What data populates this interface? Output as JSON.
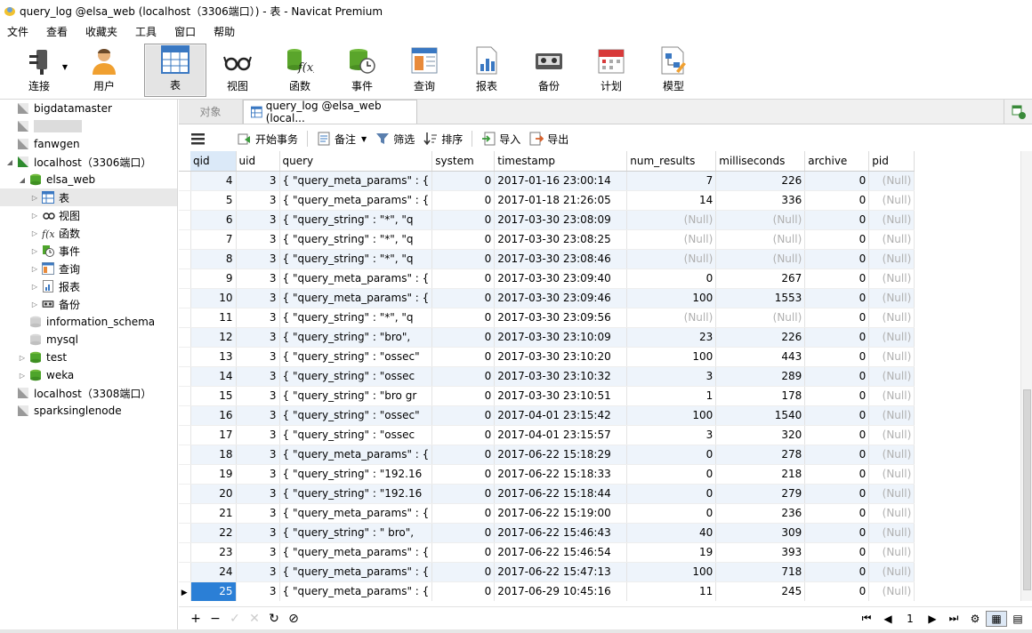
{
  "window": {
    "title": "query_log @elsa_web (localhost（3306端口）) - 表 - Navicat Premium"
  },
  "menu": [
    "文件",
    "查看",
    "收藏夹",
    "工具",
    "窗口",
    "帮助"
  ],
  "toolbar": {
    "connect": "连接",
    "user": "用户",
    "table": "表",
    "view": "视图",
    "function": "函数",
    "event": "事件",
    "query": "查询",
    "report": "报表",
    "backup": "备份",
    "schedule": "计划",
    "model": "模型"
  },
  "sidebar": {
    "items": [
      {
        "label": "bigdatamaster",
        "level": 0
      },
      {
        "label": "",
        "level": 0
      },
      {
        "label": "fanwgen",
        "level": 0
      },
      {
        "label": "localhost（3306端口）",
        "level": 0
      },
      {
        "label": "elsa_web",
        "level": 1
      },
      {
        "label": "表",
        "level": 2
      },
      {
        "label": "视图",
        "level": 2
      },
      {
        "label": "函数",
        "level": 2
      },
      {
        "label": "事件",
        "level": 2
      },
      {
        "label": "查询",
        "level": 2
      },
      {
        "label": "报表",
        "level": 2
      },
      {
        "label": "备份",
        "level": 2
      },
      {
        "label": "information_schema",
        "level": 1
      },
      {
        "label": "mysql",
        "level": 1
      },
      {
        "label": "test",
        "level": 1
      },
      {
        "label": "weka",
        "level": 1
      },
      {
        "label": "localhost（3308端口）",
        "level": 0
      },
      {
        "label": "sparksinglenode",
        "level": 0
      }
    ]
  },
  "tabs": {
    "objects": "对象",
    "active": "query_log @elsa_web (local..."
  },
  "actions": {
    "begin_tx": "开始事务",
    "note": "备注",
    "filter": "筛选",
    "sort": "排序",
    "import": "导入",
    "export": "导出"
  },
  "table": {
    "columns": [
      "qid",
      "uid",
      "query",
      "system",
      "timestamp",
      "num_results",
      "milliseconds",
      "archive",
      "pid"
    ],
    "rows": [
      [
        "4",
        "3",
        "{   \"query_meta_params\" : {",
        "0",
        "2017-01-16 23:00:14",
        "7",
        "226",
        "0",
        "(Null)"
      ],
      [
        "5",
        "3",
        "{   \"query_meta_params\" : {",
        "0",
        "2017-01-18 21:26:05",
        "14",
        "336",
        "0",
        "(Null)"
      ],
      [
        "6",
        "3",
        "{   \"query_string\" : \"*\",    \"q",
        "0",
        "2017-03-30 23:08:09",
        "(Null)",
        "(Null)",
        "0",
        "(Null)"
      ],
      [
        "7",
        "3",
        "{   \"query_string\" : \"*\",    \"q",
        "0",
        "2017-03-30 23:08:25",
        "(Null)",
        "(Null)",
        "0",
        "(Null)"
      ],
      [
        "8",
        "3",
        "{   \"query_string\" : \"*\",    \"q",
        "0",
        "2017-03-30 23:08:46",
        "(Null)",
        "(Null)",
        "0",
        "(Null)"
      ],
      [
        "9",
        "3",
        "{   \"query_meta_params\" : {",
        "0",
        "2017-03-30 23:09:40",
        "0",
        "267",
        "0",
        "(Null)"
      ],
      [
        "10",
        "3",
        "{   \"query_meta_params\" : {",
        "0",
        "2017-03-30 23:09:46",
        "100",
        "1553",
        "0",
        "(Null)"
      ],
      [
        "11",
        "3",
        "{   \"query_string\" : \"*\",    \"q",
        "0",
        "2017-03-30 23:09:56",
        "(Null)",
        "(Null)",
        "0",
        "(Null)"
      ],
      [
        "12",
        "3",
        "{   \"query_string\" : \"bro\",  ",
        "0",
        "2017-03-30 23:10:09",
        "23",
        "226",
        "0",
        "(Null)"
      ],
      [
        "13",
        "3",
        "{   \"query_string\" : \"ossec\"",
        "0",
        "2017-03-30 23:10:20",
        "100",
        "443",
        "0",
        "(Null)"
      ],
      [
        "14",
        "3",
        "{   \"query_string\" : \"ossec",
        "0",
        "2017-03-30 23:10:32",
        "3",
        "289",
        "0",
        "(Null)"
      ],
      [
        "15",
        "3",
        "{   \"query_string\" : \"bro gr",
        "0",
        "2017-03-30 23:10:51",
        "1",
        "178",
        "0",
        "(Null)"
      ],
      [
        "16",
        "3",
        "{   \"query_string\" : \"ossec\"",
        "0",
        "2017-04-01 23:15:42",
        "100",
        "1540",
        "0",
        "(Null)"
      ],
      [
        "17",
        "3",
        "{   \"query_string\" : \"ossec",
        "0",
        "2017-04-01 23:15:57",
        "3",
        "320",
        "0",
        "(Null)"
      ],
      [
        "18",
        "3",
        "{   \"query_meta_params\" : {",
        "0",
        "2017-06-22 15:18:29",
        "0",
        "278",
        "0",
        "(Null)"
      ],
      [
        "19",
        "3",
        "{   \"query_string\" : \"192.16",
        "0",
        "2017-06-22 15:18:33",
        "0",
        "218",
        "0",
        "(Null)"
      ],
      [
        "20",
        "3",
        "{   \"query_string\" : \"192.16",
        "0",
        "2017-06-22 15:18:44",
        "0",
        "279",
        "0",
        "(Null)"
      ],
      [
        "21",
        "3",
        "{   \"query_meta_params\" : {",
        "0",
        "2017-06-22 15:19:00",
        "0",
        "236",
        "0",
        "(Null)"
      ],
      [
        "22",
        "3",
        "{   \"query_string\" : \" bro\",  ",
        "0",
        "2017-06-22 15:46:43",
        "40",
        "309",
        "0",
        "(Null)"
      ],
      [
        "23",
        "3",
        "{   \"query_meta_params\" : {",
        "0",
        "2017-06-22 15:46:54",
        "19",
        "393",
        "0",
        "(Null)"
      ],
      [
        "24",
        "3",
        "{   \"query_meta_params\" : {",
        "0",
        "2017-06-22 15:47:13",
        "100",
        "718",
        "0",
        "(Null)"
      ],
      [
        "25",
        "3",
        "{   \"query_meta_params\" : {",
        "0",
        "2017-06-29 10:45:16",
        "11",
        "245",
        "0",
        "(Null)"
      ]
    ]
  },
  "pager": {
    "page": "1"
  },
  "colors": {
    "accent": "#2b7fd6",
    "alt_row": "#eef4fb",
    "null_text": "#b0b0b0"
  }
}
